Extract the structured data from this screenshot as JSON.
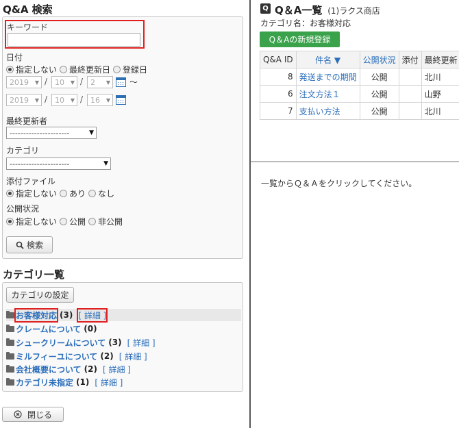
{
  "search": {
    "title": "Q&A 検索",
    "keyword_label": "キーワード",
    "keyword_value": "",
    "date_label": "日付",
    "date_options": [
      "指定しない",
      "最終更新日",
      "登録日"
    ],
    "date_from": {
      "year": "2019",
      "month": "10",
      "day": "2"
    },
    "date_to": {
      "year": "2019",
      "month": "10",
      "day": "16"
    },
    "tilde": "〜",
    "slash": "/",
    "updater_label": "最終更新者",
    "updater_value": "----------------------",
    "category_label": "カテゴリ",
    "category_value": "----------------------",
    "attach_label": "添付ファイル",
    "attach_options": [
      "指定しない",
      "あり",
      "なし"
    ],
    "publish_label": "公開状況",
    "publish_options": [
      "指定しない",
      "公開",
      "非公開"
    ],
    "search_button": "検索"
  },
  "categories": {
    "title": "カテゴリ一覧",
    "settings_button": "カテゴリの設定",
    "detail_label": "[ 詳細 ]",
    "items": [
      {
        "name": "お客様対応",
        "count": "(3)"
      },
      {
        "name": "クレームについて",
        "count": "(0)"
      },
      {
        "name": "シュークリームについて",
        "count": "(3)"
      },
      {
        "name": "ミルフィーユについて",
        "count": "(2)"
      },
      {
        "name": "会社概要について",
        "count": "(2)"
      },
      {
        "name": "カテゴリ未指定",
        "count": "(1)"
      }
    ]
  },
  "close_button": "閉じる",
  "list": {
    "icon_text": "Q",
    "title": "Q＆A一覧",
    "shop": "(1)ラクス商店",
    "category_line": "カテゴリ名：お客様対応",
    "new_button": "Q＆Aの新規登録",
    "columns": [
      "Q&A ID",
      "件名 ▼",
      "公開状況",
      "添付",
      "最終更新"
    ],
    "rows": [
      {
        "id": "8",
        "subject": "発送までの期間",
        "status": "公開",
        "attach": "",
        "updater": "北川"
      },
      {
        "id": "6",
        "subject": "注文方法１",
        "status": "公開",
        "attach": "",
        "updater": "山野"
      },
      {
        "id": "7",
        "subject": "支払い方法",
        "status": "公開",
        "attach": "",
        "updater": "北川"
      }
    ]
  },
  "detail_pane": {
    "message": "一覧からＱ＆Ａをクリックしてください。"
  },
  "colors": {
    "accent": "#2a6ebb",
    "green": "#3aa24a",
    "highlight": "#e02020"
  }
}
